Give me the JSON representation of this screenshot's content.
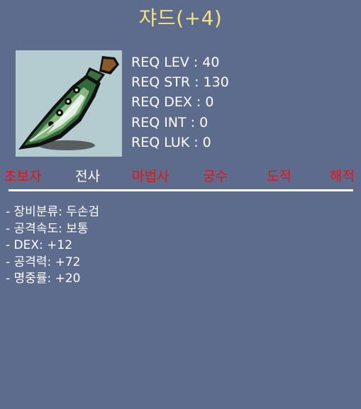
{
  "item": {
    "title": "쟈드(+4)",
    "icon_name": "green-two-handed-sword-icon"
  },
  "requirements": [
    "REQ LEV : 40",
    "REQ STR : 130",
    "REQ DEX : 0",
    "REQ INT : 0",
    "REQ LUK : 0"
  ],
  "jobs": [
    {
      "label": "초보자",
      "color": "#ee1111"
    },
    {
      "label": "전사",
      "color": "#ffffff"
    },
    {
      "label": "마법사",
      "color": "#ee1111"
    },
    {
      "label": "궁수",
      "color": "#ee1111"
    },
    {
      "label": "도적",
      "color": "#ee1111"
    },
    {
      "label": "해적",
      "color": "#ee1111"
    }
  ],
  "stats": [
    "- 장비분류: 두손검",
    "- 공격속도: 보통",
    "- DEX: +12",
    "- 공격력: +72",
    "- 명중률: +20"
  ],
  "colors": {
    "background": "#5d6c8c",
    "title": "#f3e27a",
    "unavailable_job": "#ee1111",
    "available_job": "#ffffff"
  }
}
